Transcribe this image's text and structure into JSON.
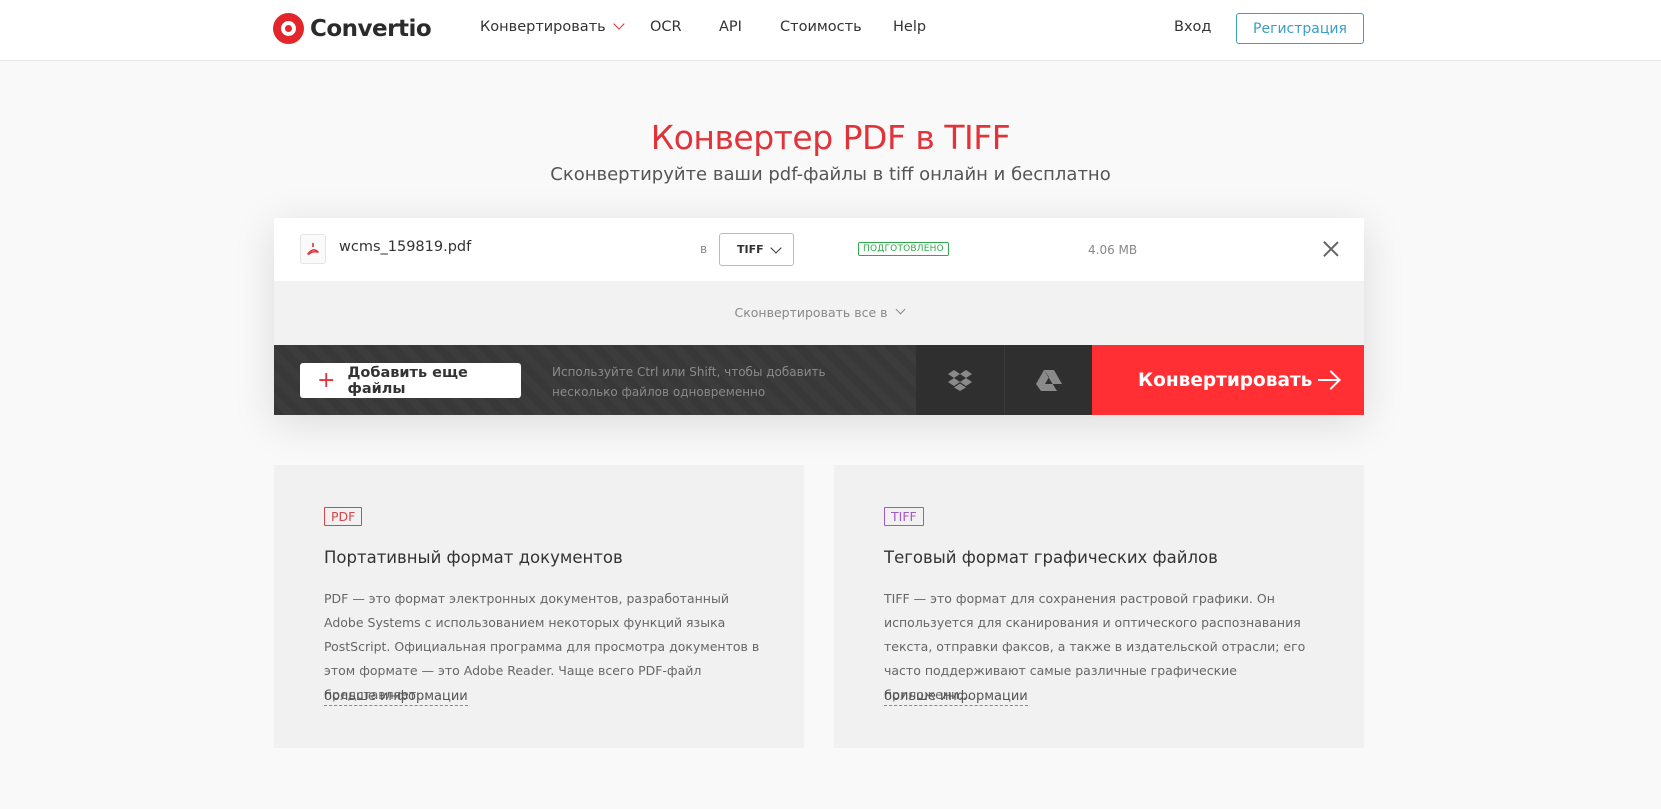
{
  "header": {
    "logo_text": "Convertio",
    "nav": [
      {
        "label": "Конвертировать"
      },
      {
        "label": "OCR"
      },
      {
        "label": "API"
      },
      {
        "label": "Стоимость"
      },
      {
        "label": "Help"
      }
    ],
    "login": "Вход",
    "signup": "Регистрация"
  },
  "hero": {
    "title": "Конвертер PDF в TIFF",
    "subtitle": "Сконвертируйте ваши pdf-файлы в tiff онлайн и бесплатно"
  },
  "file": {
    "icon": "pdf-icon",
    "name": "wcms_159819.pdf",
    "to_label": "в",
    "format": "TIFF",
    "status": "ПОДГОТОВЛЕНО",
    "size": "4.06 MB"
  },
  "convert_all": "Сконвертировать все в",
  "actions": {
    "add_files": "Добавить еще файлы",
    "hint": "Используйте Ctrl или Shift, чтобы добавить несколько файлов одновременно",
    "dropbox_icon": "dropbox-icon",
    "gdrive_icon": "google-drive-icon",
    "convert": "Конвертировать"
  },
  "cards": [
    {
      "tag": "PDF",
      "title": "Портативный формат документов",
      "text": "PDF — это формат электронных документов, разработанный Adobe Systems с использованием некоторых функций языка PostScript. Официальная программа для просмотра документов в этом формате — это Adobe Reader. Чаще всего PDF-файл представляет...",
      "more": "больше информации"
    },
    {
      "tag": "TIFF",
      "title": "Теговый формат графических файлов",
      "text": "TIFF — это формат для сохранения растровой графики. Он используется для сканирования и оптического распознавания текста, отправки факсов, а также в издательской отрасли; его часто поддерживают самые различные графические приложени...",
      "more": "больше информации"
    }
  ],
  "colors": {
    "brand_red": "#e3262c",
    "convert_button": "#ff2f34",
    "signup_blue": "#3a9fc6",
    "status_green": "#2eaa4a"
  }
}
